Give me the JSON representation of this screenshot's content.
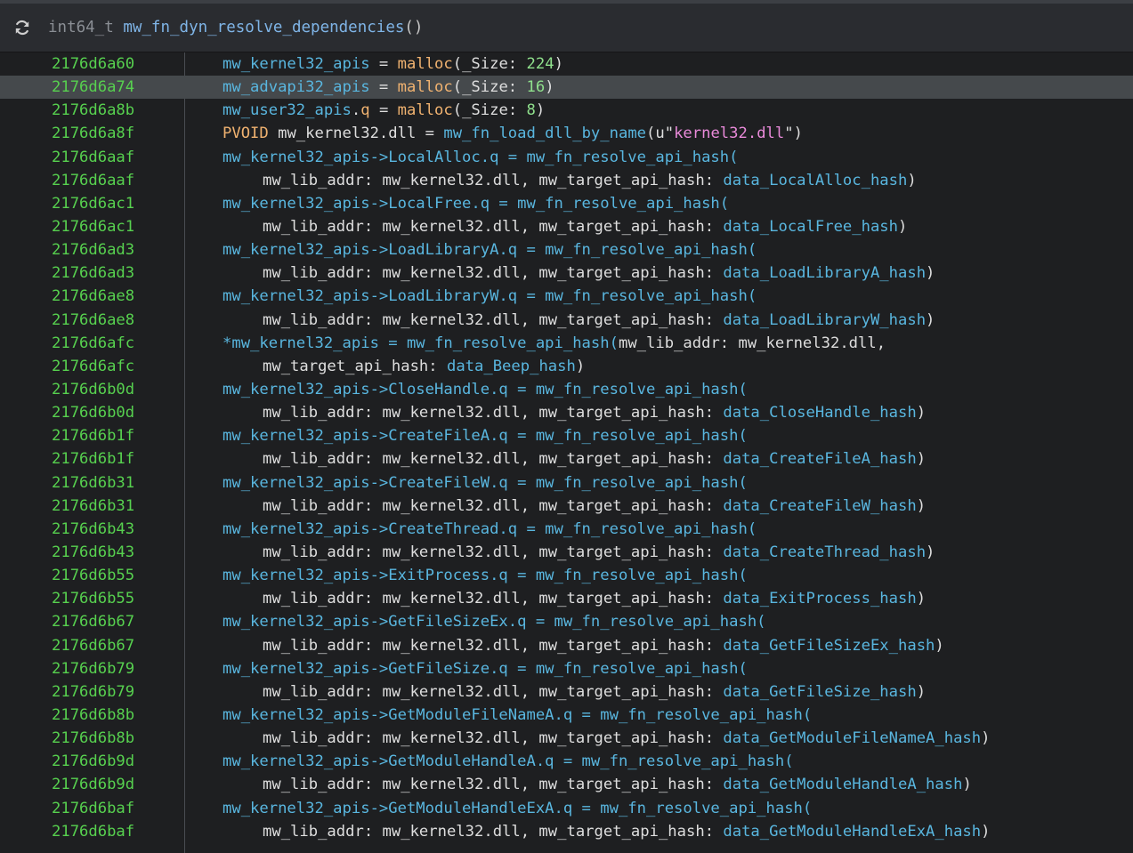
{
  "header": {
    "return_type": "int64_t",
    "function_name": "mw_fn_dyn_resolve_dependencies",
    "parens": "()",
    "refresh_icon": "refresh-icon"
  },
  "colors": {
    "address": "#57d14f",
    "variable": "#59b6df",
    "function_call": "#f0b270",
    "number": "#8fe08c",
    "string": "#e98ad9",
    "highlight_row": "#45494c"
  },
  "rows": [
    {
      "addr": "2176d6a60",
      "v1": "mw_kernel32_apis",
      "p1": " = ",
      "f1": "malloc",
      "p2": "(_Size: ",
      "n1": "224",
      "p3": ")"
    },
    {
      "addr": "2176d6a74",
      "v1": "mw_advapi32_apis",
      "p1": " = ",
      "f1": "malloc",
      "p2": "(_Size: ",
      "n1": "16",
      "p3": ")"
    },
    {
      "addr": "2176d6a8b",
      "v1": "mw_user32_apis",
      "p1": ".",
      "q1": "q",
      "p2": " = ",
      "f1": "malloc",
      "p3": "(_Size: ",
      "n1": "8",
      "p4": ")"
    },
    {
      "addr": "2176d6a8f",
      "t1": "PVOID",
      "p1": " mw_kernel32.dll = ",
      "v1": "mw_fn_load_dll_by_name",
      "p2": "(u\"",
      "s1": "kernel32.dll",
      "p3": "\")"
    },
    {
      "addr": "2176d6aaf",
      "v1": "mw_kernel32_apis->LocalAlloc.q = mw_fn_resolve_api_hash("
    },
    {
      "addr": "2176d6aaf",
      "p1": "mw_lib_addr: mw_kernel32.dll, mw_target_api_hash: ",
      "v1": "data_LocalAlloc_hash",
      "p2": ")"
    },
    {
      "addr": "2176d6ac1",
      "v1": "mw_kernel32_apis->LocalFree.q = mw_fn_resolve_api_hash("
    },
    {
      "addr": "2176d6ac1",
      "p1": "mw_lib_addr: mw_kernel32.dll, mw_target_api_hash: ",
      "v1": "data_LocalFree_hash",
      "p2": ")"
    },
    {
      "addr": "2176d6ad3",
      "v1": "mw_kernel32_apis->LoadLibraryA.q = mw_fn_resolve_api_hash("
    },
    {
      "addr": "2176d6ad3",
      "p1": "mw_lib_addr: mw_kernel32.dll, mw_target_api_hash: ",
      "v1": "data_LoadLibraryA_hash",
      "p2": ")"
    },
    {
      "addr": "2176d6ae8",
      "v1": "mw_kernel32_apis->LoadLibraryW.q = mw_fn_resolve_api_hash("
    },
    {
      "addr": "2176d6ae8",
      "p1": "mw_lib_addr: mw_kernel32.dll, mw_target_api_hash: ",
      "v1": "data_LoadLibraryW_hash",
      "p2": ")"
    },
    {
      "addr": "2176d6afc",
      "v1": "*mw_kernel32_apis = mw_fn_resolve_api_hash(",
      "p1": "mw_lib_addr: mw_kernel32.dll,"
    },
    {
      "addr": "2176d6afc",
      "p1": "mw_target_api_hash: ",
      "v1": "data_Beep_hash",
      "p2": ")"
    },
    {
      "addr": "2176d6b0d",
      "v1": "mw_kernel32_apis->CloseHandle.q = mw_fn_resolve_api_hash("
    },
    {
      "addr": "2176d6b0d",
      "p1": "mw_lib_addr: mw_kernel32.dll, mw_target_api_hash: ",
      "v1": "data_CloseHandle_hash",
      "p2": ")"
    },
    {
      "addr": "2176d6b1f",
      "v1": "mw_kernel32_apis->CreateFileA.q = mw_fn_resolve_api_hash("
    },
    {
      "addr": "2176d6b1f",
      "p1": "mw_lib_addr: mw_kernel32.dll, mw_target_api_hash: ",
      "v1": "data_CreateFileA_hash",
      "p2": ")"
    },
    {
      "addr": "2176d6b31",
      "v1": "mw_kernel32_apis->CreateFileW.q = mw_fn_resolve_api_hash("
    },
    {
      "addr": "2176d6b31",
      "p1": "mw_lib_addr: mw_kernel32.dll, mw_target_api_hash: ",
      "v1": "data_CreateFileW_hash",
      "p2": ")"
    },
    {
      "addr": "2176d6b43",
      "v1": "mw_kernel32_apis->CreateThread.q = mw_fn_resolve_api_hash("
    },
    {
      "addr": "2176d6b43",
      "p1": "mw_lib_addr: mw_kernel32.dll, mw_target_api_hash: ",
      "v1": "data_CreateThread_hash",
      "p2": ")"
    },
    {
      "addr": "2176d6b55",
      "v1": "mw_kernel32_apis->ExitProcess.q = mw_fn_resolve_api_hash("
    },
    {
      "addr": "2176d6b55",
      "p1": "mw_lib_addr: mw_kernel32.dll, mw_target_api_hash: ",
      "v1": "data_ExitProcess_hash",
      "p2": ")"
    },
    {
      "addr": "2176d6b67",
      "v1": "mw_kernel32_apis->GetFileSizeEx.q = mw_fn_resolve_api_hash("
    },
    {
      "addr": "2176d6b67",
      "p1": "mw_lib_addr: mw_kernel32.dll, mw_target_api_hash: ",
      "v1": "data_GetFileSizeEx_hash",
      "p2": ")"
    },
    {
      "addr": "2176d6b79",
      "v1": "mw_kernel32_apis->GetFileSize.q = mw_fn_resolve_api_hash("
    },
    {
      "addr": "2176d6b79",
      "p1": "mw_lib_addr: mw_kernel32.dll, mw_target_api_hash: ",
      "v1": "data_GetFileSize_hash",
      "p2": ")"
    },
    {
      "addr": "2176d6b8b",
      "v1": "mw_kernel32_apis->GetModuleFileNameA.q = mw_fn_resolve_api_hash("
    },
    {
      "addr": "2176d6b8b",
      "p1": "mw_lib_addr: mw_kernel32.dll, mw_target_api_hash: ",
      "v1": "data_GetModuleFileNameA_hash",
      "p2": ")"
    },
    {
      "addr": "2176d6b9d",
      "v1": "mw_kernel32_apis->GetModuleHandleA.q = mw_fn_resolve_api_hash("
    },
    {
      "addr": "2176d6b9d",
      "p1": "mw_lib_addr: mw_kernel32.dll, mw_target_api_hash: ",
      "v1": "data_GetModuleHandleA_hash",
      "p2": ")"
    },
    {
      "addr": "2176d6baf",
      "v1": "mw_kernel32_apis->GetModuleHandleExA.q = mw_fn_resolve_api_hash("
    },
    {
      "addr": "2176d6baf",
      "p1": "mw_lib_addr: mw_kernel32.dll, mw_target_api_hash: ",
      "v1": "data_GetModuleHandleExA_hash",
      "p2": ")"
    }
  ]
}
